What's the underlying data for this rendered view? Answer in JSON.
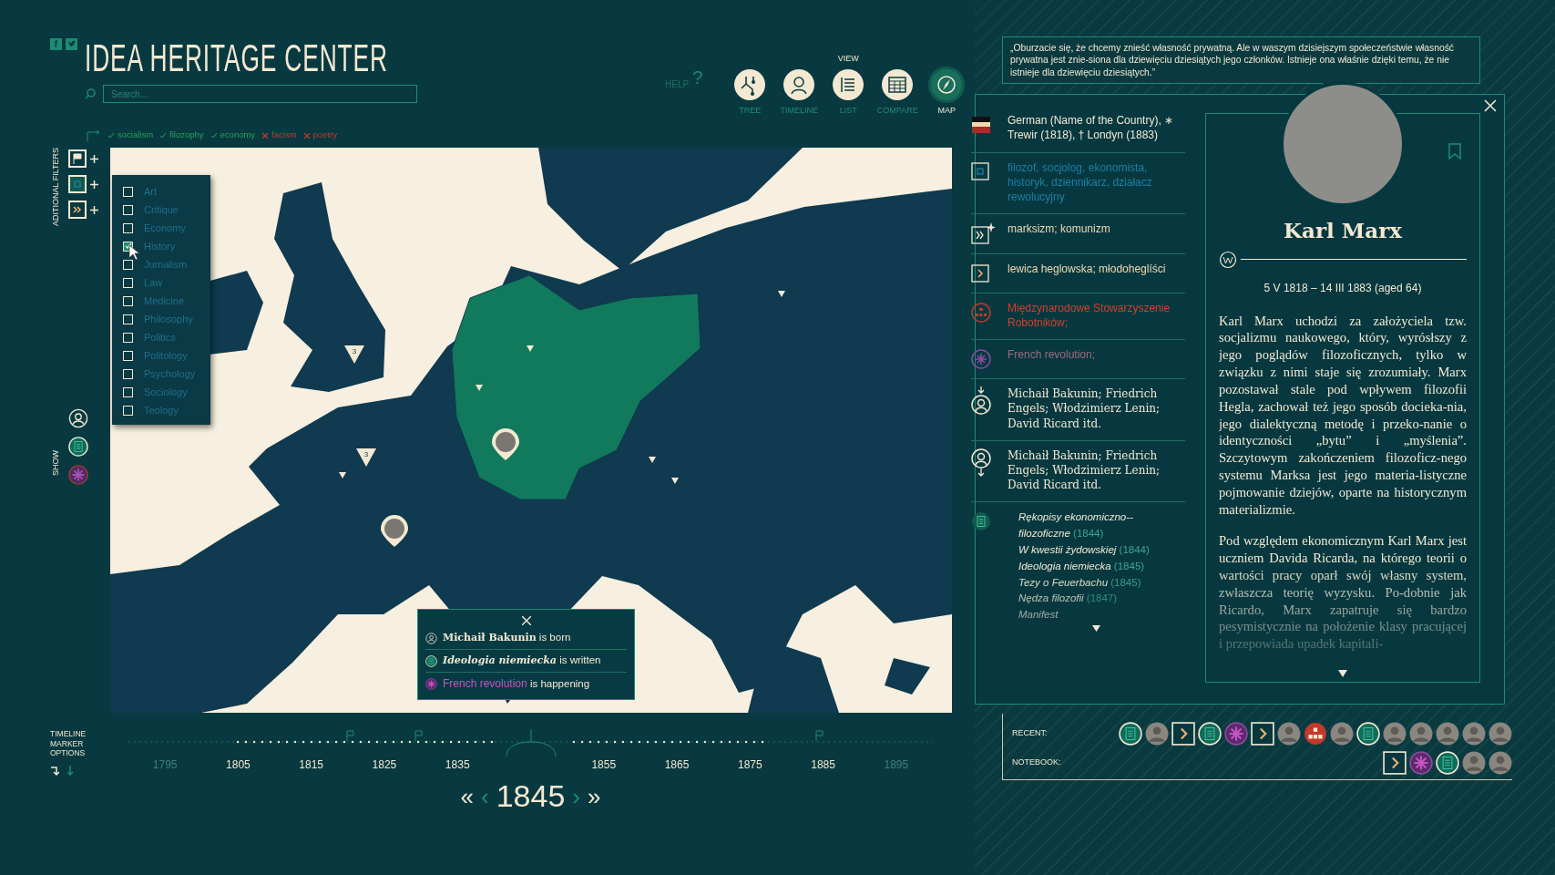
{
  "header": {
    "social": [
      {
        "kind": "letter",
        "text": "f"
      },
      {
        "kind": "bird"
      }
    ],
    "title": "IDEA HERITAGE CENTER",
    "search": {
      "placeholder": "Search..."
    },
    "help": {
      "label": "HELP",
      "mark": "?"
    },
    "view": {
      "label": "VIEW",
      "items": [
        {
          "label": "TREE",
          "kind": "tree",
          "selected": false
        },
        {
          "label": "TIMELINE",
          "kind": "timeline",
          "selected": false
        },
        {
          "label": "LIST",
          "kind": "list",
          "selected": false
        },
        {
          "label": "COMPARE",
          "kind": "compare",
          "selected": false
        },
        {
          "label": "MAP",
          "kind": "map",
          "selected": true
        }
      ]
    }
  },
  "quote": "„Oburzacie się, że chcemy znieść własność prywatną. Ale w waszym dzisiejszym społeczeństwie własność prywatna jest znie-siona dla dziewięciu dziesiątych jego członków. Istnieje ona właśnie dzięki temu, że nie istnieje dla dziewięciu dziesiątych.”",
  "filters": {
    "label": "ADITIONAL FILTERS",
    "show_label": "SHOW",
    "tags": [
      {
        "label": "socialism",
        "included": true
      },
      {
        "label": "filozophy",
        "included": true
      },
      {
        "label": "economy",
        "included": true
      },
      {
        "label": "facism",
        "included": false
      },
      {
        "label": "poetry",
        "included": false
      }
    ],
    "buttons": [
      {
        "kind": "flag"
      },
      {
        "kind": "profession",
        "expanded": true
      },
      {
        "kind": "ideology"
      }
    ],
    "show": [
      {
        "kind": "person",
        "on": true
      },
      {
        "kind": "work",
        "on": true
      },
      {
        "kind": "event",
        "on": false
      }
    ],
    "categories": [
      {
        "label": "Art",
        "checked": false
      },
      {
        "label": "Critique",
        "checked": false
      },
      {
        "label": "Economy",
        "checked": false
      },
      {
        "label": "History",
        "checked": true
      },
      {
        "label": "Jurnalism",
        "checked": false
      },
      {
        "label": "Law",
        "checked": false
      },
      {
        "label": "Medicine",
        "checked": false
      },
      {
        "label": "Philosophy",
        "checked": false
      },
      {
        "label": "Politics",
        "checked": false
      },
      {
        "label": "Politology",
        "checked": false
      },
      {
        "label": "Psychology",
        "checked": false
      },
      {
        "label": "Sociology",
        "checked": false
      },
      {
        "label": "Teology",
        "checked": false
      }
    ]
  },
  "map": {
    "clusters": [
      {
        "count": "3"
      },
      {
        "count": "3"
      }
    ],
    "popup": {
      "events": [
        {
          "kind": "person",
          "title": "Michaił Bakunin",
          "text": "is born"
        },
        {
          "kind": "work",
          "title": "Ideologia niemiecka",
          "text": "is written"
        },
        {
          "kind": "event",
          "title": "French revolution",
          "text": "is happening"
        }
      ]
    }
  },
  "info": {
    "rows": [
      {
        "kind": "country",
        "text": "German (Name of the Country), ∗ Trewir (1818), † Londyn (1883)"
      },
      {
        "kind": "professions",
        "text": "filozof, socjolog, ekonomista, historyk, dziennikarz, działacz rewolucyjny"
      },
      {
        "kind": "ideologies",
        "text": "marksizm; komunizm"
      },
      {
        "kind": "schools",
        "text": "lewica heglowska; młodoheglíści"
      },
      {
        "kind": "organizations",
        "text": "Międzynarodowe Stowarzyszenie Robotników;"
      },
      {
        "kind": "events",
        "text": "French revolution;"
      },
      {
        "kind": "influenced_by",
        "text": "Michaił Bakunin; Friedrich Engels; Włodzimierz Lenin; David Ricard itd."
      },
      {
        "kind": "influences",
        "text": "Michaił Bakunin; Friedrich Engels; Włodzimierz Lenin; David Ricard itd."
      },
      {
        "kind": "works",
        "works": [
          {
            "title": "Rękopisy ekonomiczno--filozoficzne",
            "year": "(1844)"
          },
          {
            "title": "W kwestii żydowskiej",
            "year": "(1844)"
          },
          {
            "title": "Ideologia niemiecka",
            "year": "(1845)"
          },
          {
            "title": "Tezy o Feuerbachu",
            "year": "(1845)"
          },
          {
            "title": "Nędza filozofii",
            "year": "(1847)"
          },
          {
            "title": "Manifest"
          }
        ]
      }
    ]
  },
  "article": {
    "name": "Karl Marx",
    "dates": "5 V 1818 – 14 III 1883 (aged 64)",
    "paragraphs": [
      "Karl Marx uchodzi za założyciela tzw. socjalizmu naukowego, który, wyrósłszy z jego poglądów filozoficznych, tylko w związku z nimi staje się zrozumiały. Marx pozostawał stale pod wpływem filozofii Hegla, zachował też jego sposób docieka-nia, jego dialektyczną metodę i przeko-nanie o identyczności „bytu” i „myślenia”. Szczytowym zakończeniem filozoficz-nego systemu Marksa jest jego materia-listyczne pojmowanie dziejów, oparte na historycznym materializmie.",
      "Pod względem ekonomicznym Karl Marx jest uczniem Davida Ricarda, na którego teorii o wartości pracy oparł swój własny system, zwłaszcza teorię wyzysku. Po-dobnie jak Ricardo, Marx zapatruje się bardzo pesymistycznie na położenie klasy pracującej i przepowiada upadek kapitali-"
    ]
  },
  "timeline": {
    "label": "TIMELINE MARKER OPTIONS",
    "ticks": [
      {
        "label": "1795",
        "dim": true
      },
      {
        "label": "1805",
        "dim": false
      },
      {
        "label": "1815",
        "dim": false
      },
      {
        "label": "1825",
        "dim": false
      },
      {
        "label": "1835",
        "dim": false
      },
      {
        "label": "1855",
        "dim": false
      },
      {
        "label": "1865",
        "dim": false
      },
      {
        "label": "1875",
        "dim": false
      },
      {
        "label": "1885",
        "dim": false
      },
      {
        "label": "1895",
        "dim": true
      }
    ],
    "current": "1845",
    "nav": [
      "«",
      "‹",
      "›",
      "»"
    ]
  },
  "recent": {
    "label": "RECENT:",
    "items": [
      {
        "kind": "work"
      },
      {
        "kind": "portrait"
      },
      {
        "kind": "school"
      },
      {
        "kind": "work"
      },
      {
        "kind": "event"
      },
      {
        "kind": "school"
      },
      {
        "kind": "portrait"
      },
      {
        "kind": "organization"
      },
      {
        "kind": "portrait"
      },
      {
        "kind": "work"
      },
      {
        "kind": "portrait"
      },
      {
        "kind": "portrait"
      },
      {
        "kind": "portrait"
      },
      {
        "kind": "portrait"
      },
      {
        "kind": "portrait"
      }
    ]
  },
  "notebook": {
    "label": "NOTEBOOK:",
    "items": [
      {
        "kind": "school"
      },
      {
        "kind": "event"
      },
      {
        "kind": "work"
      },
      {
        "kind": "portrait"
      },
      {
        "kind": "portrait"
      }
    ]
  }
}
